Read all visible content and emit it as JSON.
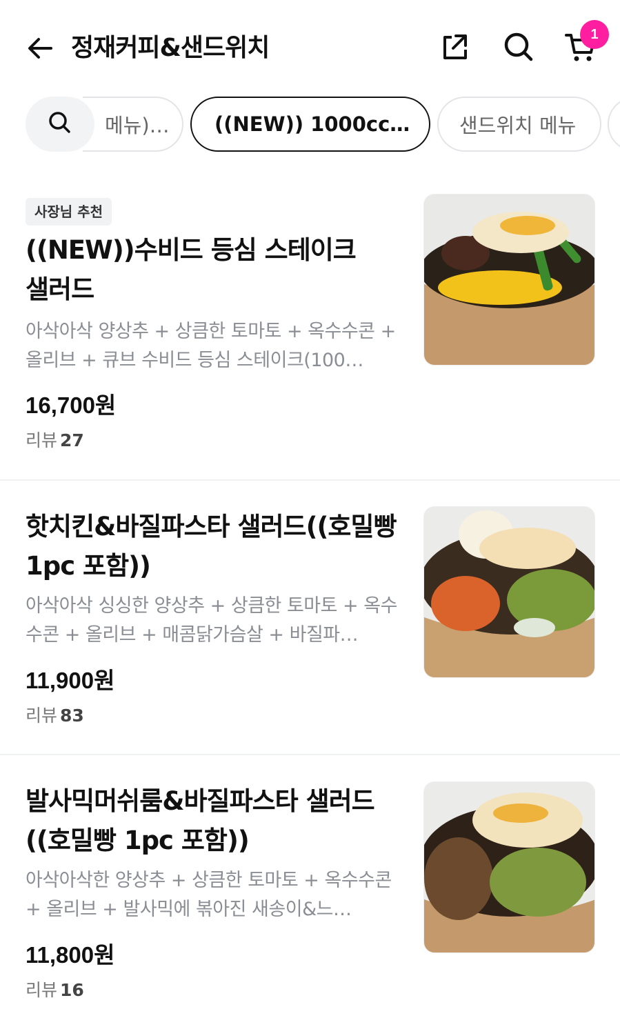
{
  "header": {
    "title": "정재커피&샌드위치",
    "cart_count": "1"
  },
  "icons": {
    "back": "arrow-left-icon",
    "share": "share-icon",
    "search": "search-icon",
    "cart": "cart-icon"
  },
  "tabs": [
    {
      "label": "메뉴)…"
    },
    {
      "label": "((NEW)) 1000cc…",
      "active": true
    },
    {
      "label": "샌드위치 메뉴"
    }
  ],
  "items": [
    {
      "badge": "사장님 추천",
      "name": "((NEW))수비드 등심 스테이크 샐러드",
      "desc": "아삭아삭 양상추 + 상큼한 토마토 + 옥수수콘 + 올리브 + 큐브 수비드 등심 스테이크(100…",
      "price": "16,700원",
      "review_label": "리뷰",
      "review_count": "27"
    },
    {
      "name": "핫치킨&바질파스타 샐러드((호밀빵 1pc 포함))",
      "desc": "아삭아삭 싱싱한 양상추 + 상큼한 토마토 + 옥수수콘 + 올리브 + 매콤닭가슴살 + 바질파…",
      "price": "11,900원",
      "review_label": "리뷰",
      "review_count": "83"
    },
    {
      "name": "발사믹머쉬룸&바질파스타 샐러드((호밀빵 1pc 포함))",
      "desc": "아삭아삭한 양상추 + 상큼한 토마토 + 옥수수콘 + 올리브 + 발사믹에 볶아진 새송이&느…",
      "price": "11,800원",
      "review_label": "리뷰",
      "review_count": "16"
    }
  ],
  "colors": {
    "badge_pink": "#ff1ea0",
    "text_primary": "#111111",
    "text_secondary": "#8a8d93"
  }
}
